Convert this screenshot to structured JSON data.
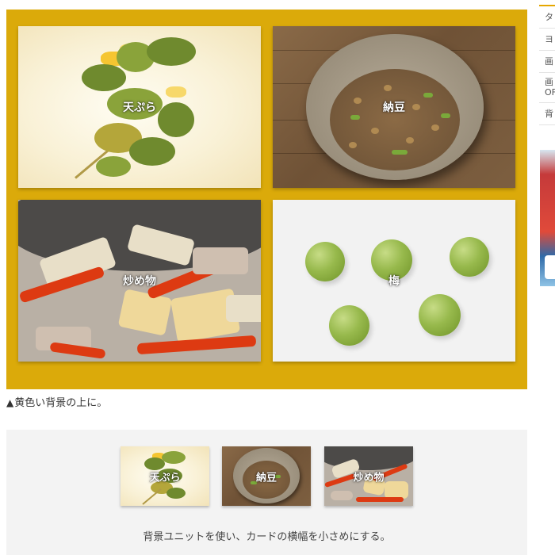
{
  "cards": [
    {
      "label": "天ぷら"
    },
    {
      "label": "納豆"
    },
    {
      "label": "炒め物"
    },
    {
      "label": "梅"
    }
  ],
  "caption": {
    "icon": "▲",
    "text": "黄色い背景の上に。"
  },
  "thumbs": [
    {
      "label": "天ぷら"
    },
    {
      "label": "納豆"
    },
    {
      "label": "炒め物"
    }
  ],
  "gray_caption": "背景ユニットを使い、カードの横幅を小さめにする。",
  "sidebar": {
    "items": [
      "タ",
      "ヨ",
      "画",
      "画\nOF",
      "背"
    ]
  },
  "colors": {
    "yellow_panel": "#dbaa0a",
    "gray_panel": "#f3f3f3",
    "sidebar_accent": "#e6a700"
  },
  "icons": {
    "caption_icon": "triangle-up-icon"
  }
}
